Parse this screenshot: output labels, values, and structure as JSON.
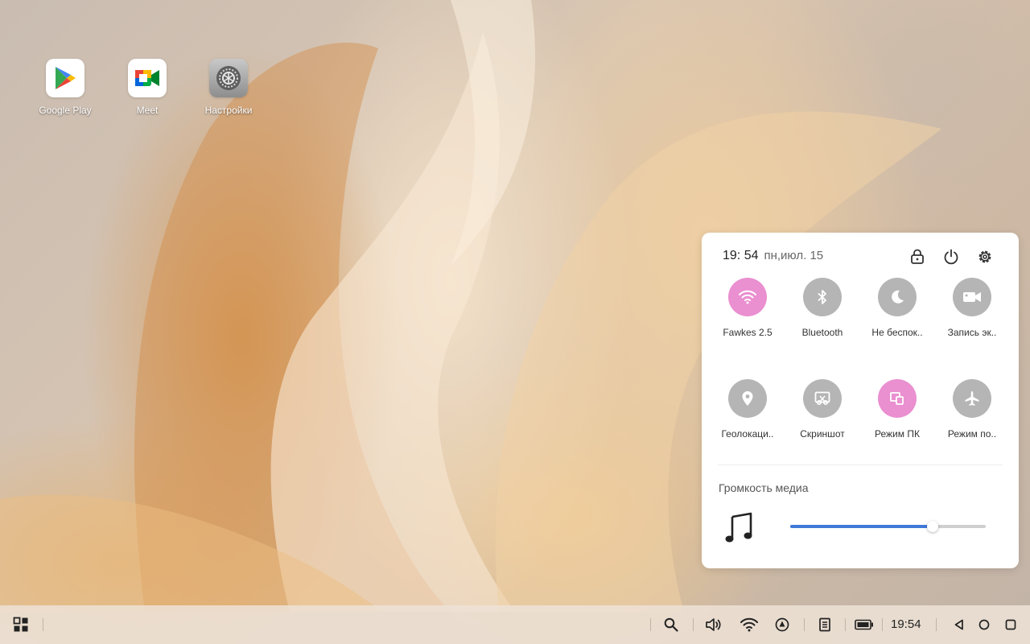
{
  "desktop": {
    "icons": [
      {
        "label": "Google Play",
        "icon": "google-play-icon"
      },
      {
        "label": "Meet",
        "icon": "google-meet-icon"
      },
      {
        "label": "Настройки",
        "icon": "settings-app-icon"
      }
    ]
  },
  "quick_panel": {
    "time": "19: 54",
    "date": "пн,июл. 15",
    "header_icons": [
      "lock-icon",
      "power-icon",
      "gear-icon"
    ],
    "tiles": [
      {
        "label": "Fawkes 2.5",
        "icon": "wifi-icon",
        "active": true
      },
      {
        "label": "Bluetooth",
        "icon": "bluetooth-icon",
        "active": false
      },
      {
        "label": "Не беспок..",
        "icon": "moon-icon",
        "active": false
      },
      {
        "label": "Запись эк..",
        "icon": "video-camera-icon",
        "active": false
      },
      {
        "label": "Геолокаци..",
        "icon": "location-pin-icon",
        "active": false
      },
      {
        "label": "Скриншот",
        "icon": "screenshot-icon",
        "active": false
      },
      {
        "label": "Режим ПК",
        "icon": "pc-mode-icon",
        "active": true
      },
      {
        "label": "Режим по..",
        "icon": "airplane-icon",
        "active": false
      }
    ],
    "volume": {
      "title": "Громкость медиа",
      "icon": "music-note-icon",
      "level": 0.73
    }
  },
  "taskbar": {
    "clock": "19:54",
    "icons": [
      "start-menu-icon",
      "search-icon",
      "volume-icon",
      "wifi-icon",
      "navigation-icon",
      "notes-icon",
      "battery-icon",
      "back-icon",
      "home-icon",
      "recents-icon"
    ]
  },
  "colors": {
    "active_tile": "#ea8fd0",
    "inactive_tile": "#b5b5b5",
    "slider_fill": "#3f79d9"
  }
}
